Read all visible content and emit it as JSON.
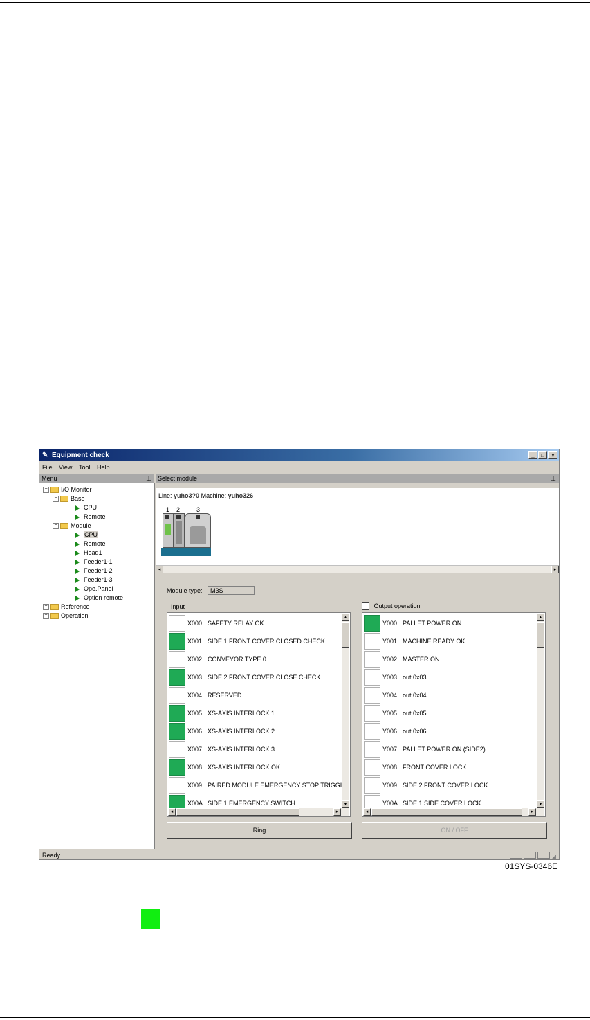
{
  "caption": "01SYS-0346E",
  "window": {
    "title": "Equipment check",
    "controls": [
      "_",
      "□",
      "×"
    ],
    "menus": [
      "File",
      "View",
      "Tool",
      "Help"
    ]
  },
  "left_pane": {
    "header": "Menu",
    "tree": {
      "io_monitor": "I/O Monitor",
      "base": "Base",
      "base_cpu": "CPU",
      "base_remote": "Remote",
      "module": "Module",
      "module_cpu": "CPU",
      "module_remote": "Remote",
      "head1": "Head1",
      "feeder1": "Feeder1-1",
      "feeder2": "Feeder1-2",
      "feeder3": "Feeder1-3",
      "ope_panel": "Ope.Panel",
      "option_remote": "Option remote",
      "reference": "Reference",
      "operation": "Operation"
    }
  },
  "select_module": {
    "header": "Select module",
    "line_label": "Line:",
    "line_value": "yuho3?0",
    "machine_label": "Machine:",
    "machine_value": "yuho326",
    "module_numbers": [
      "1",
      "2",
      "3"
    ]
  },
  "module_type": {
    "label": "Module type:",
    "value": "M3S"
  },
  "input": {
    "label": "Input",
    "rows": [
      {
        "code": "X000",
        "name": "SAFETY RELAY OK",
        "on": false
      },
      {
        "code": "X001",
        "name": "SIDE 1 FRONT COVER CLOSED CHECK",
        "on": true
      },
      {
        "code": "X002",
        "name": "CONVEYOR TYPE 0",
        "on": false
      },
      {
        "code": "X003",
        "name": "SIDE 2 FRONT COVER CLOSE CHECK",
        "on": true
      },
      {
        "code": "X004",
        "name": "RESERVED",
        "on": false
      },
      {
        "code": "X005",
        "name": "XS-AXIS INTERLOCK 1",
        "on": true
      },
      {
        "code": "X006",
        "name": "XS-AXIS INTERLOCK 2",
        "on": true
      },
      {
        "code": "X007",
        "name": "XS-AXIS INTERLOCK 3",
        "on": false
      },
      {
        "code": "X008",
        "name": "XS-AXIS INTERLOCK OK",
        "on": true
      },
      {
        "code": "X009",
        "name": "PAIRED MODULE EMERGENCY STOP TRIGGI",
        "on": false
      },
      {
        "code": "X00A",
        "name": "SIDE 1 EMERGENCY SWITCH",
        "on": true
      }
    ],
    "button": "Ring"
  },
  "output": {
    "label": "Output operation",
    "checked": false,
    "rows": [
      {
        "code": "Y000",
        "name": "PALLET POWER ON",
        "on": true
      },
      {
        "code": "Y001",
        "name": "MACHINE READY OK",
        "on": false
      },
      {
        "code": "Y002",
        "name": "MASTER ON",
        "on": false
      },
      {
        "code": "Y003",
        "name": "out 0x03",
        "on": false
      },
      {
        "code": "Y004",
        "name": "out 0x04",
        "on": false
      },
      {
        "code": "Y005",
        "name": "out 0x05",
        "on": false
      },
      {
        "code": "Y006",
        "name": "out 0x06",
        "on": false
      },
      {
        "code": "Y007",
        "name": "PALLET POWER ON (SIDE2)",
        "on": false
      },
      {
        "code": "Y008",
        "name": "FRONT COVER LOCK",
        "on": false
      },
      {
        "code": "Y009",
        "name": "SIDE 2 FRONT COVER LOCK",
        "on": false
      },
      {
        "code": "Y00A",
        "name": "SIDE 1 SIDE COVER LOCK",
        "on": false
      }
    ],
    "button": "ON / OFF"
  },
  "status": {
    "text": "Ready"
  },
  "colors": {
    "on_indicator": "#1faa55",
    "legend_green": "#11ee11",
    "title_bar": "#0a246a"
  }
}
